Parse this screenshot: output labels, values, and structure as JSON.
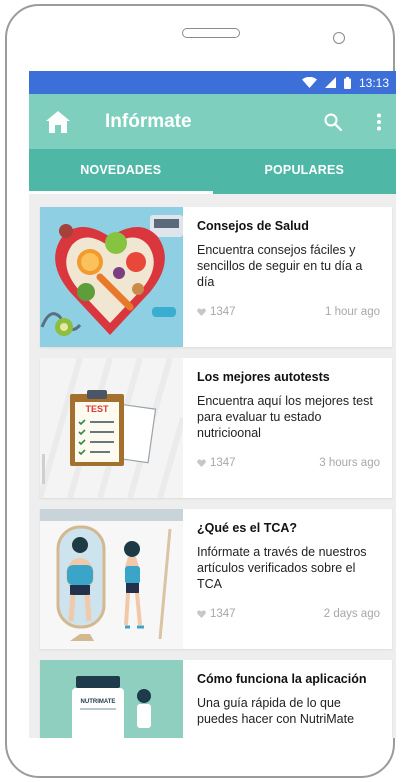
{
  "status_bar": {
    "time": "13:13",
    "icons": [
      "wifi-icon",
      "signal-icon",
      "battery-icon"
    ]
  },
  "app_bar": {
    "title": "Infórmate",
    "icons": [
      "home-icon",
      "search-icon",
      "more-vert-icon"
    ]
  },
  "tabs": [
    {
      "label": "NOVEDADES",
      "selected": true
    },
    {
      "label": "POPULARES",
      "selected": false
    }
  ],
  "articles": [
    {
      "title": "Consejos de Salud",
      "description": "Encuentra consejos fáciles y sencillos de seguir en tu día a día",
      "likes": "1347",
      "time": "1 hour ago",
      "image": "healthy-food-illustration"
    },
    {
      "title": "Los mejores autotests",
      "description": "Encuentra aquí los mejores test para evaluar tu estado nutricioonal",
      "likes": "1347",
      "time": "3 hours ago",
      "image": "clipboard-test-illustration",
      "image_text": "TEST"
    },
    {
      "title": "¿Qué es el TCA?",
      "description": "Infórmate a través de nuestros artículos verificados sobre el TCA",
      "likes": "1347",
      "time": "2 days ago",
      "image": "mirror-illustration"
    },
    {
      "title": "Cómo funciona la aplicación",
      "description": "Una guía rápida de lo que puedes hacer con NutriMate",
      "likes": "",
      "time": "",
      "image": "nutrimate-illustration",
      "image_text": "NUTRIMATE"
    }
  ],
  "colors": {
    "status_bar": "#3d6fd9",
    "app_bar": "#7fcfbf",
    "tab_bar": "#4fb7a6",
    "list_background": "#eeeeee"
  }
}
